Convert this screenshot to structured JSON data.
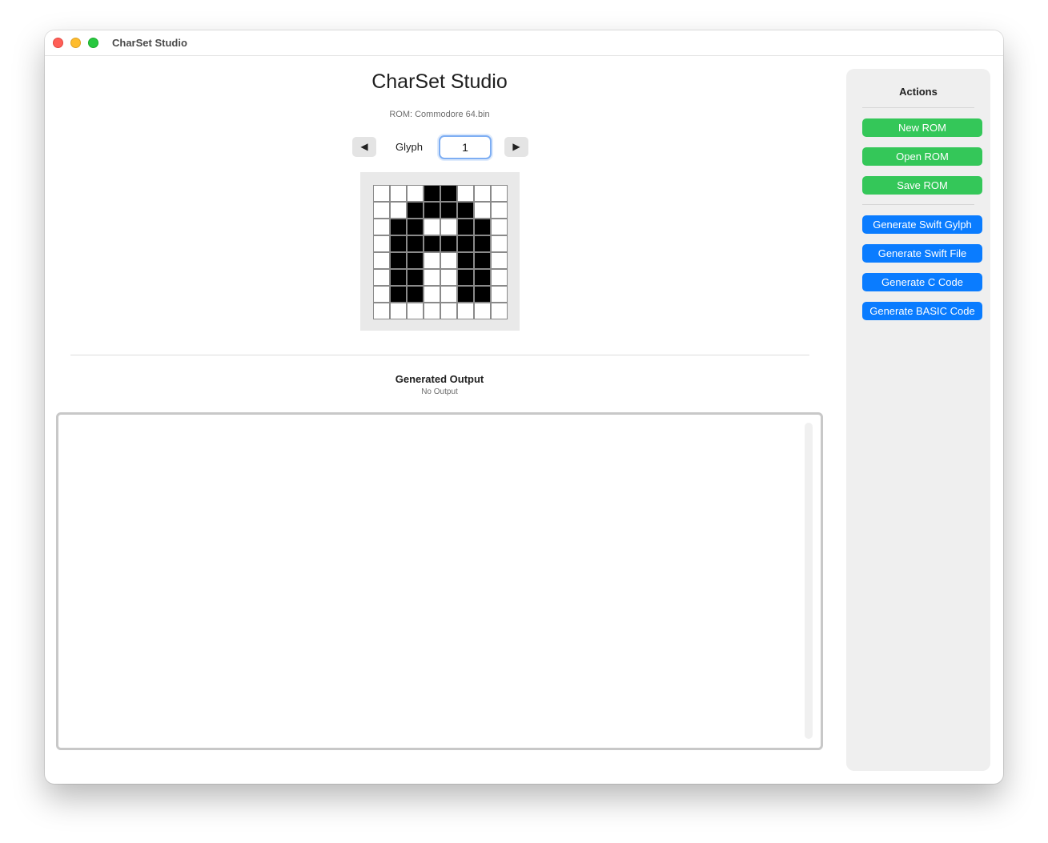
{
  "window": {
    "title": "CharSet Studio"
  },
  "header": {
    "app_title": "CharSet Studio",
    "rom_label": "ROM: Commodore 64.bin"
  },
  "glyph_nav": {
    "prev_icon": "◀",
    "next_icon": "▶",
    "label": "Glyph",
    "value": "1"
  },
  "glyph_grid": {
    "rows": [
      [
        0,
        0,
        0,
        1,
        1,
        0,
        0,
        0
      ],
      [
        0,
        0,
        1,
        1,
        1,
        1,
        0,
        0
      ],
      [
        0,
        1,
        1,
        0,
        0,
        1,
        1,
        0
      ],
      [
        0,
        1,
        1,
        1,
        1,
        1,
        1,
        0
      ],
      [
        0,
        1,
        1,
        0,
        0,
        1,
        1,
        0
      ],
      [
        0,
        1,
        1,
        0,
        0,
        1,
        1,
        0
      ],
      [
        0,
        1,
        1,
        0,
        0,
        1,
        1,
        0
      ],
      [
        0,
        0,
        0,
        0,
        0,
        0,
        0,
        0
      ]
    ]
  },
  "output": {
    "title": "Generated Output",
    "status": "No Output",
    "text": ""
  },
  "sidebar": {
    "title": "Actions",
    "file_buttons": [
      "New ROM",
      "Open ROM",
      "Save ROM"
    ],
    "generate_buttons": [
      "Generate Swift Gylph",
      "Generate Swift File",
      "Generate C Code",
      "Generate BASIC Code"
    ]
  },
  "colors": {
    "green_button": "#34c759",
    "blue_button": "#0a7cff",
    "focus_ring": "#7eaef3",
    "pixel_on": "#000000",
    "pixel_off": "#ffffff"
  }
}
